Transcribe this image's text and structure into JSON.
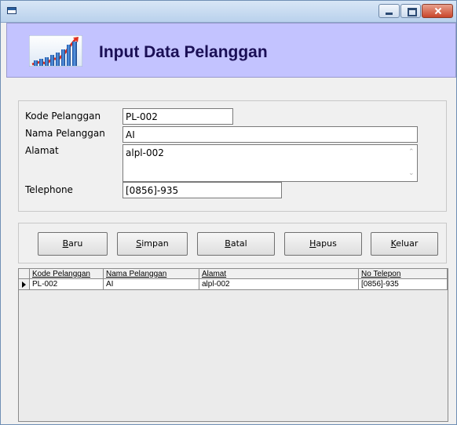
{
  "window": {
    "title": ""
  },
  "header": {
    "title": "Input Data Pelanggan"
  },
  "form": {
    "kode_label": "Kode Pelanggan",
    "kode_value": "PL-002",
    "nama_label": "Nama Pelanggan",
    "nama_value": "AI",
    "alamat_label": "Alamat",
    "alamat_value": "alpl-002",
    "telephone_label": "Telephone",
    "telephone_value": "[0856]-935"
  },
  "buttons": {
    "baru": "Baru",
    "simpan": "Simpan",
    "batal": "Batal",
    "hapus": "Hapus",
    "keluar": "Keluar"
  },
  "grid": {
    "columns": [
      "Kode Pelanggan",
      "Nama Pelanggan",
      "Alamat",
      "No Telepon"
    ],
    "rows": [
      [
        "PL-002",
        "AI",
        "alpl-002",
        "[0856]-935"
      ]
    ]
  },
  "icons": {
    "app": "window-app-icon",
    "logo": "growth-chart-logo",
    "minimize": "minimize-icon",
    "maximize": "maximize-icon",
    "close": "close-icon"
  },
  "colors": {
    "header_bg": "#c3c3ff",
    "title_text": "#1a0f55",
    "close_button": "#c9462c"
  }
}
